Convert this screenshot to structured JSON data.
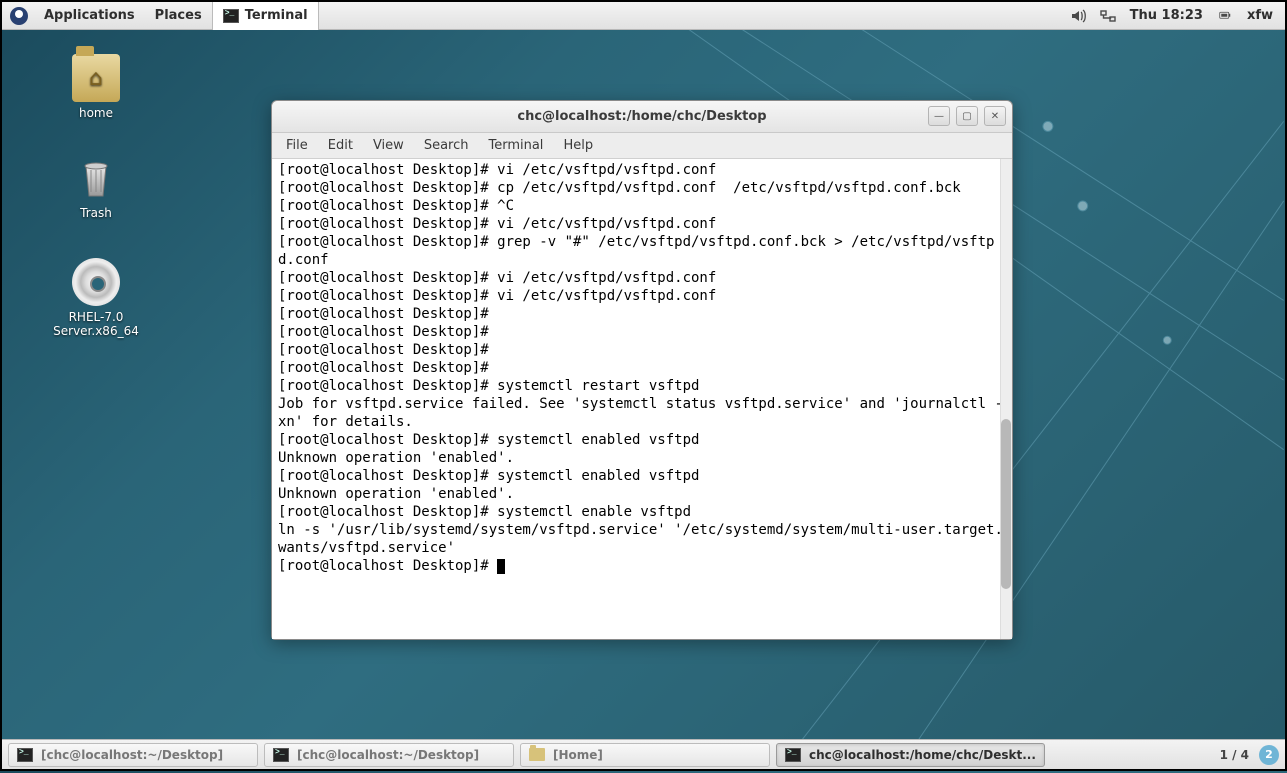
{
  "top_panel": {
    "applications": "Applications",
    "places": "Places",
    "task_title": "Terminal",
    "clock": "Thu 18:23",
    "user": "xfw"
  },
  "desktop_icons": {
    "home": "home",
    "trash": "Trash",
    "dvd": "RHEL-7.0 Server.x86_64"
  },
  "terminal": {
    "title": "chc@localhost:/home/chc/Desktop",
    "menus": {
      "file": "File",
      "edit": "Edit",
      "view": "View",
      "search": "Search",
      "terminal": "Terminal",
      "help": "Help"
    },
    "lines": [
      "[root@localhost Desktop]# vi /etc/vsftpd/vsftpd.conf",
      "[root@localhost Desktop]# cp /etc/vsftpd/vsftpd.conf  /etc/vsftpd/vsftpd.conf.bck",
      "[root@localhost Desktop]# ^C",
      "[root@localhost Desktop]# vi /etc/vsftpd/vsftpd.conf",
      "[root@localhost Desktop]# grep -v \"#\" /etc/vsftpd/vsftpd.conf.bck > /etc/vsftpd/vsftpd.conf",
      "[root@localhost Desktop]# vi /etc/vsftpd/vsftpd.conf",
      "[root@localhost Desktop]# vi /etc/vsftpd/vsftpd.conf",
      "[root@localhost Desktop]# ",
      "[root@localhost Desktop]# ",
      "[root@localhost Desktop]# ",
      "[root@localhost Desktop]# ",
      "[root@localhost Desktop]# systemctl restart vsftpd",
      "Job for vsftpd.service failed. See 'systemctl status vsftpd.service' and 'journalctl -xn' for details.",
      "[root@localhost Desktop]# systemctl enabled vsftpd",
      "Unknown operation 'enabled'.",
      "[root@localhost Desktop]# systemctl enabled vsftpd",
      "Unknown operation 'enabled'.",
      "[root@localhost Desktop]# systemctl enable vsftpd",
      "ln -s '/usr/lib/systemd/system/vsftpd.service' '/etc/systemd/system/multi-user.target.wants/vsftpd.service'",
      "[root@localhost Desktop]# "
    ]
  },
  "bottom_panel": {
    "tasks": [
      {
        "label": "[chc@localhost:~/Desktop]",
        "type": "terminal",
        "active": false
      },
      {
        "label": "[chc@localhost:~/Desktop]",
        "type": "terminal",
        "active": false
      },
      {
        "label": "[Home]",
        "type": "files",
        "active": false
      },
      {
        "label": "chc@localhost:/home/chc/Deskt...",
        "type": "terminal",
        "active": true
      }
    ],
    "workspace": "1 / 4",
    "ws_badge": "2"
  }
}
